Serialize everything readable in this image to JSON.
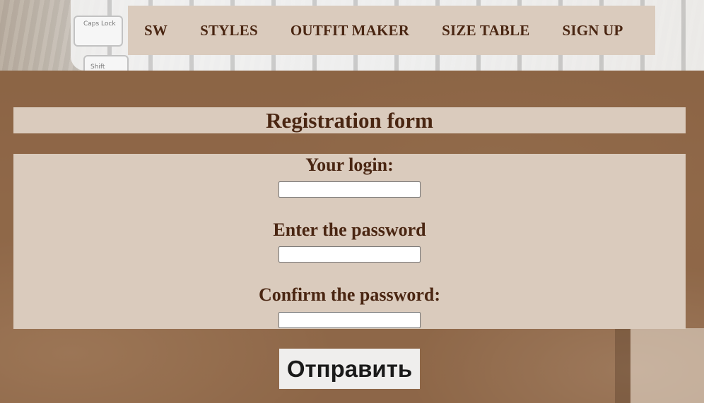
{
  "nav": {
    "items": [
      {
        "label": "SW"
      },
      {
        "label": "STYLES"
      },
      {
        "label": "OUTFIT MAKER"
      },
      {
        "label": "SIZE TABLE"
      },
      {
        "label": "SIGN UP"
      }
    ]
  },
  "background": {
    "keys": {
      "caps_lock": "Caps Lock",
      "shift": "Shift"
    }
  },
  "form": {
    "title": "Registration form",
    "login_label": "Your login:",
    "login_value": "",
    "password_label": "Enter the password",
    "password_value": "",
    "confirm_label": "Confirm the password:",
    "confirm_value": "",
    "submit_label": "Отправить"
  },
  "colors": {
    "panel": "#dacbbd",
    "text": "#4a2612",
    "button": "#efeeed"
  }
}
